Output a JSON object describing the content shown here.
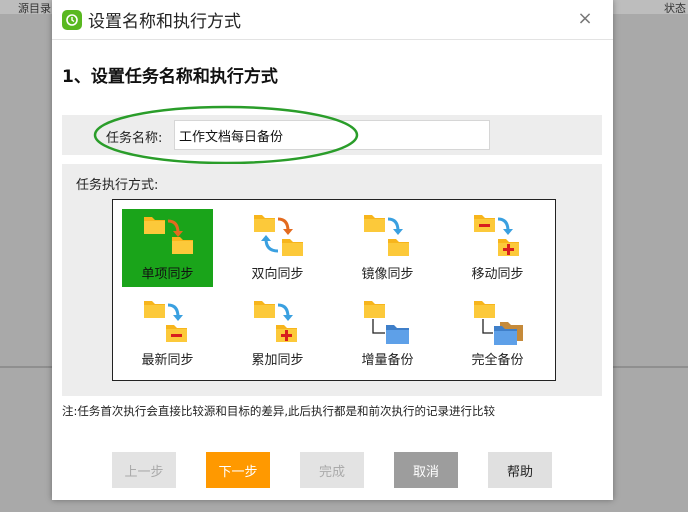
{
  "background": {
    "left_column": "源目录",
    "right_column": "状态"
  },
  "dialog": {
    "title": "设置名称和执行方式",
    "close": "×",
    "heading": "1、设置任务名称和执行方式",
    "task_name_label": "任务名称:",
    "task_name_value": "工作文档每日备份",
    "mode_label": "任务执行方式:",
    "modes": [
      {
        "label": "单项同步",
        "icon": "one-way-sync-icon",
        "selected": true
      },
      {
        "label": "双向同步",
        "icon": "two-way-sync-icon",
        "selected": false
      },
      {
        "label": "镜像同步",
        "icon": "mirror-sync-icon",
        "selected": false
      },
      {
        "label": "移动同步",
        "icon": "move-sync-icon",
        "selected": false
      },
      {
        "label": "最新同步",
        "icon": "latest-sync-icon",
        "selected": false
      },
      {
        "label": "累加同步",
        "icon": "cumulative-sync-icon",
        "selected": false
      },
      {
        "label": "增量备份",
        "icon": "incremental-backup-icon",
        "selected": false
      },
      {
        "label": "完全备份",
        "icon": "full-backup-icon",
        "selected": false
      }
    ],
    "note": "注:任务首次执行会直接比较源和目标的差异,此后执行都是和前次执行的记录进行比较",
    "buttons": {
      "prev": "上一步",
      "next": "下一步",
      "finish": "完成",
      "cancel": "取消",
      "help": "帮助"
    }
  },
  "colors": {
    "selected_tile": "#1aa41a",
    "primary_button": "#ff9900",
    "highlight_ellipse": "#2a9d2a",
    "folder": "#f7b51c",
    "sync_arrow": "#3aa0e0"
  }
}
